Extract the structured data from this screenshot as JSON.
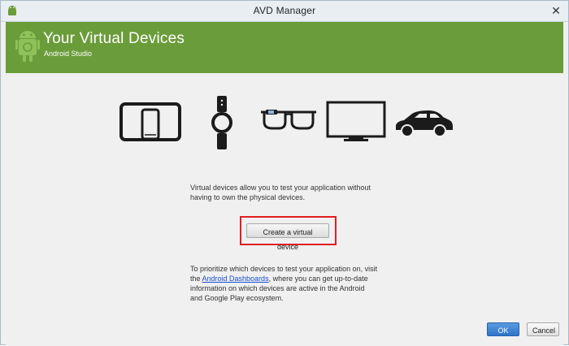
{
  "window": {
    "title": "AVD Manager",
    "close_glyph": "✕"
  },
  "banner": {
    "title": "Your Virtual Devices",
    "subtitle": "Android Studio",
    "color": "#6b9c3a"
  },
  "devices": {
    "icons": [
      "tablet-phone-icon",
      "watch-icon",
      "glasses-icon",
      "tv-icon",
      "car-icon"
    ]
  },
  "intro_text": "Virtual devices allow you to test your application without having to own the physical devices.",
  "create_button": {
    "label": "Create a virtual device",
    "highlight_color": "#e11d1d"
  },
  "info": {
    "before_link": "To prioritize which devices to test your application on, visit the ",
    "link_text": "Android Dashboards",
    "after_link": ", where you can get up-to-date information on which devices are active in the Android and Google Play ecosystem."
  },
  "footer": {
    "ok_label": "OK",
    "cancel_label": "Cancel"
  }
}
